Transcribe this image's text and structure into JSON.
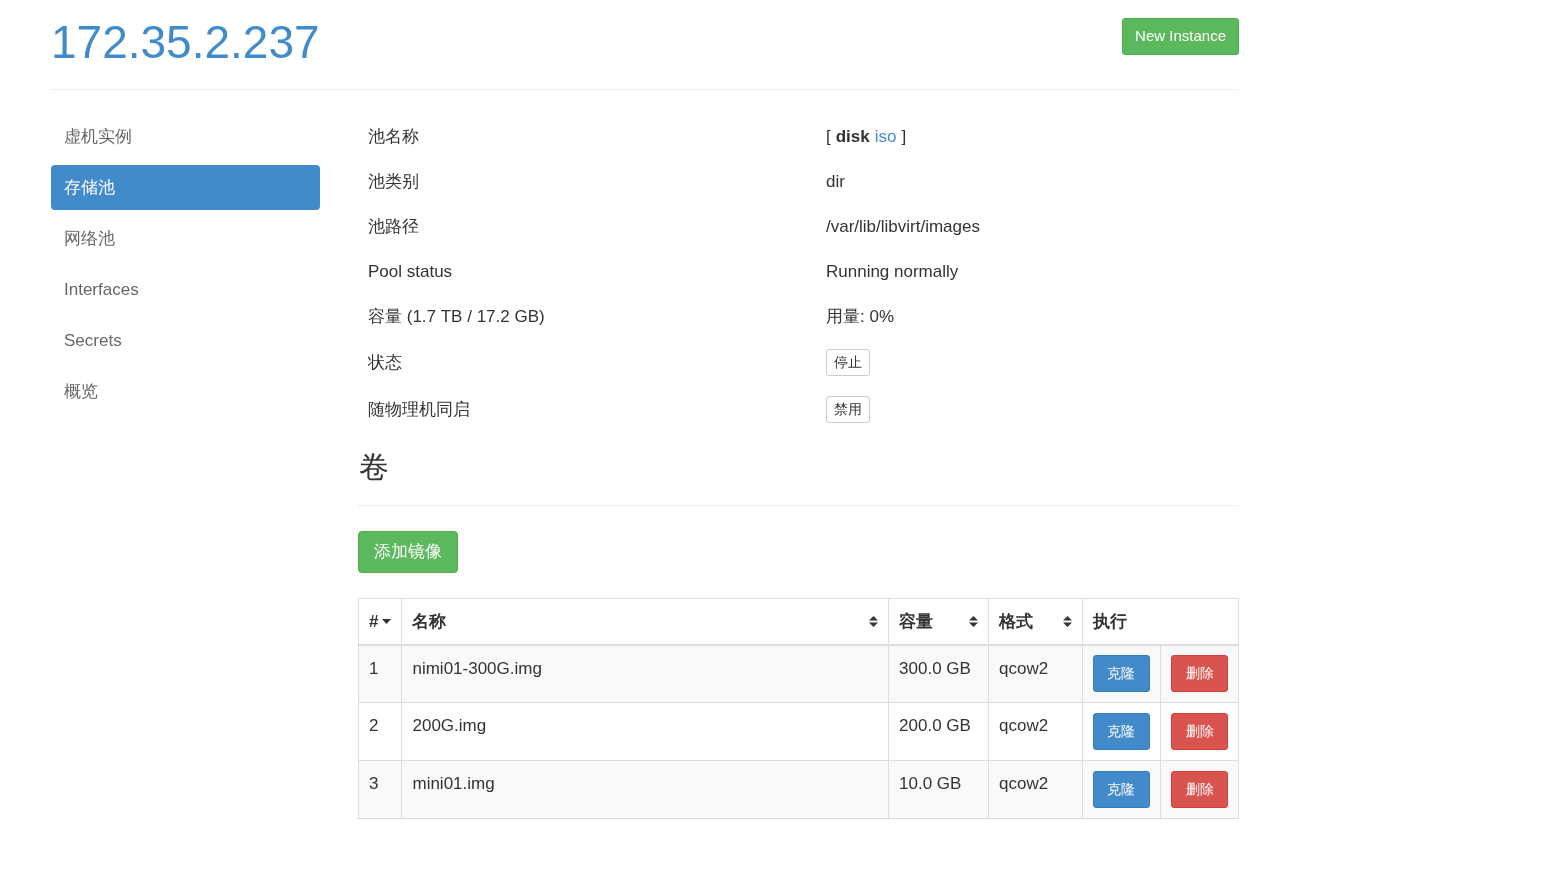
{
  "header": {
    "title": "172.35.2.237",
    "new_button": "New Instance"
  },
  "sidebar": {
    "items": [
      {
        "label": "虚机实例",
        "selected": false
      },
      {
        "label": "存储池",
        "selected": true
      },
      {
        "label": "网络池",
        "selected": false
      },
      {
        "label": "Interfaces",
        "selected": false
      },
      {
        "label": "Secrets",
        "selected": false
      },
      {
        "label": "概览",
        "selected": false
      }
    ]
  },
  "details": [
    {
      "kind": "pools",
      "label": "池名称",
      "open": "[",
      "close": "]",
      "pools": [
        {
          "name": "disk",
          "selected": true
        },
        {
          "name": "iso",
          "selected": false
        }
      ]
    },
    {
      "kind": "text",
      "label": "池类别",
      "value": "dir"
    },
    {
      "kind": "text",
      "label": "池路径",
      "value": "/var/lib/libvirt/images"
    },
    {
      "kind": "text",
      "label": "Pool status",
      "value": "Running normally"
    },
    {
      "kind": "text",
      "label": "容量 (1.7 TB / 17.2 GB)",
      "value": "用量: 0%"
    },
    {
      "kind": "button",
      "label": "状态",
      "value": "停止"
    },
    {
      "kind": "button",
      "label": "随物理机同启",
      "value": "禁用"
    }
  ],
  "volumes": {
    "heading": "卷",
    "add_button": "添加镜像",
    "columns": [
      {
        "label": "#",
        "sortable": true,
        "sorted": true
      },
      {
        "label": "名称",
        "sortable": true,
        "sorted": false
      },
      {
        "label": "容量",
        "sortable": true,
        "sorted": false
      },
      {
        "label": "格式",
        "sortable": true,
        "sorted": false
      },
      {
        "label": "执行",
        "sortable": false,
        "sorted": false
      }
    ],
    "rows": [
      {
        "index": "1",
        "name": "nimi01-300G.img",
        "size": "300.0 GB",
        "format": "qcow2",
        "clone": "克隆",
        "delete": "删除"
      },
      {
        "index": "2",
        "name": "200G.img",
        "size": "200.0 GB",
        "format": "qcow2",
        "clone": "克隆",
        "delete": "删除"
      },
      {
        "index": "3",
        "name": "mini01.img",
        "size": "10.0 GB",
        "format": "qcow2",
        "clone": "克隆",
        "delete": "删除"
      }
    ]
  }
}
